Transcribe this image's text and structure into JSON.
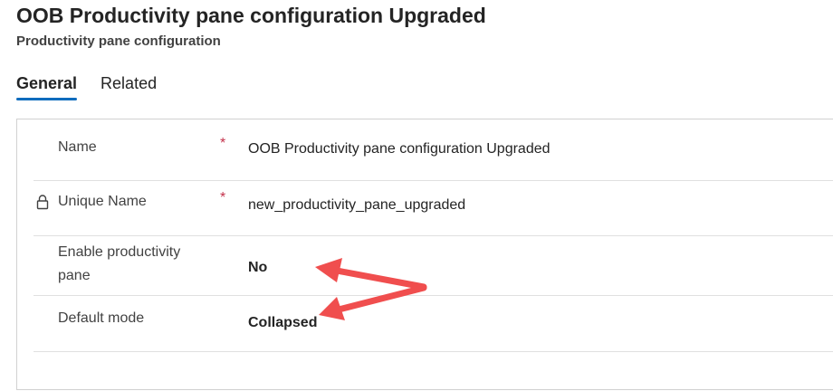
{
  "header": {
    "title": "OOB Productivity pane configuration Upgraded",
    "subtitle": "Productivity pane configuration"
  },
  "tabs": [
    {
      "label": "General",
      "active": true
    },
    {
      "label": "Related",
      "active": false
    }
  ],
  "fields": {
    "name": {
      "label": "Name",
      "required_mark": "*",
      "value": "OOB Productivity pane configuration Upgraded"
    },
    "unique_name": {
      "label": "Unique Name",
      "required_mark": "*",
      "value": "new_productivity_pane_upgraded",
      "icon": "lock-icon"
    },
    "enable_pane": {
      "label": "Enable productivity pane",
      "value": "No"
    },
    "default_mode": {
      "label": "Default mode",
      "value": "Collapsed"
    }
  },
  "colors": {
    "accent": "#0f6cbd",
    "required": "#c4314b",
    "annotation_arrow": "#f04e4e"
  }
}
